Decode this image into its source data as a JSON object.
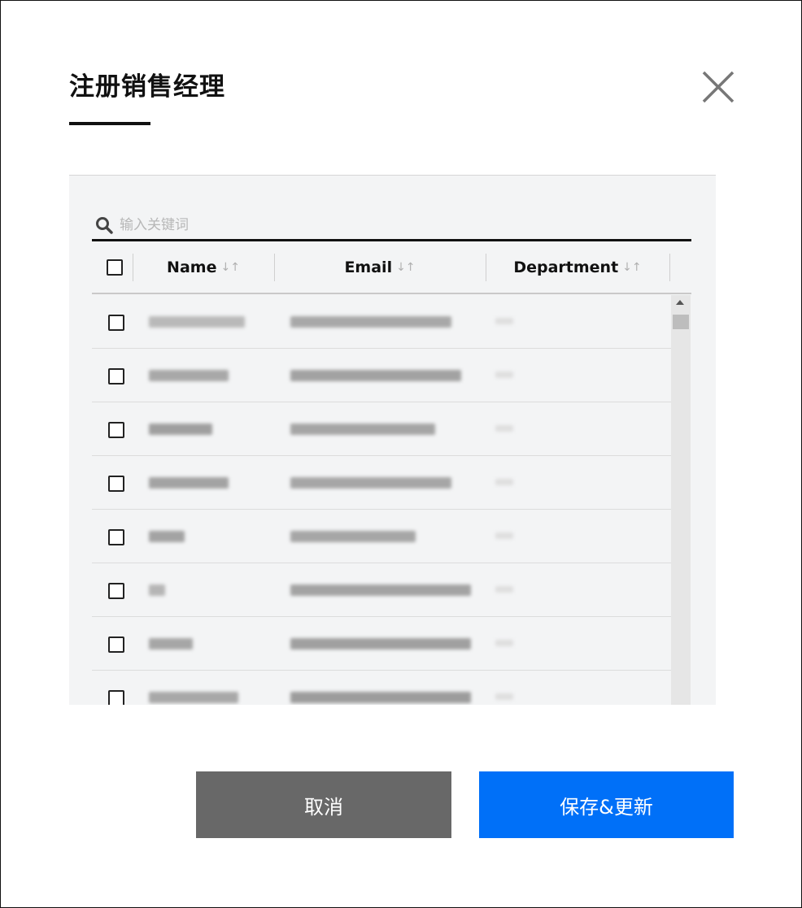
{
  "dialog": {
    "title": "注册销售经理",
    "close_icon": "close-icon"
  },
  "search": {
    "placeholder": "输入关键词",
    "icon": "search-icon"
  },
  "table": {
    "columns": [
      {
        "label": "Name",
        "sort": "↓↑"
      },
      {
        "label": "Email",
        "sort": "↓↑"
      },
      {
        "label": "Department",
        "sort": "↓↑"
      }
    ],
    "rows": [
      {
        "name": "[blurred]",
        "email": "[blurred]",
        "department": "[blurred]"
      },
      {
        "name": "[blurred]",
        "email": "[blurred]",
        "department": "[blurred]"
      },
      {
        "name": "[blurred]",
        "email": "[blurred]",
        "department": "[blurred]"
      },
      {
        "name": "[blurred]",
        "email": "[blurred]",
        "department": "[blurred]"
      },
      {
        "name": "[blurred]",
        "email": "[blurred]",
        "department": "[blurred]"
      },
      {
        "name": "[blurred]",
        "email": "[blurred]",
        "department": "[blurred]"
      },
      {
        "name": "[blurred]",
        "email": "[blurred]",
        "department": "[blurred]"
      },
      {
        "name": "[blurred]",
        "email": "[blurred]",
        "department": "[blurred]"
      }
    ]
  },
  "buttons": {
    "cancel": "取消",
    "save": "保存&更新"
  },
  "colors": {
    "primary": "#0070f8",
    "cancel": "#686868",
    "panel_bg": "#f3f4f5"
  }
}
